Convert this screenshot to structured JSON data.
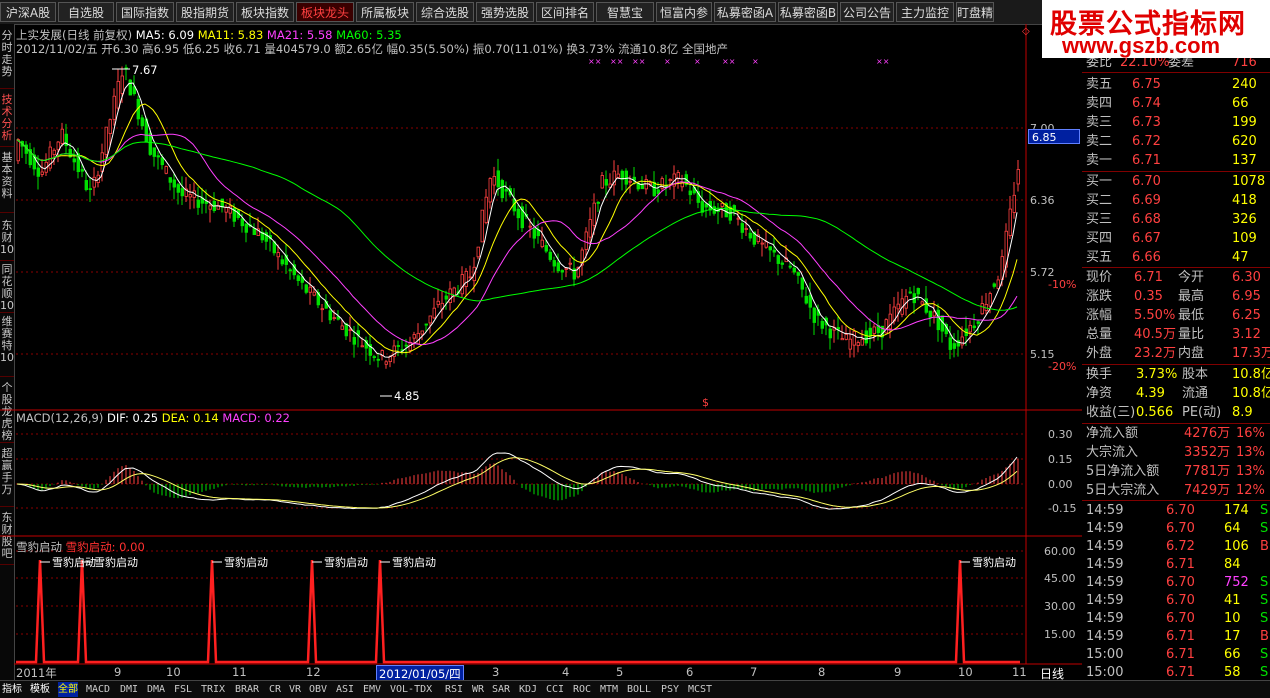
{
  "top_tabs": [
    {
      "label": "沪深A股",
      "active": false
    },
    {
      "label": "自选股",
      "active": false
    },
    {
      "label": "国际指数",
      "active": false
    },
    {
      "label": "股指期货",
      "active": false
    },
    {
      "label": "板块指数",
      "active": false
    },
    {
      "label": "板块龙头",
      "active": true
    },
    {
      "label": "所属板块",
      "active": false
    },
    {
      "label": "综合选股",
      "active": false
    },
    {
      "label": "强势选股",
      "active": false
    },
    {
      "label": "区间排名",
      "active": false
    },
    {
      "label": "智慧宝",
      "active": false
    },
    {
      "label": "恒富内参",
      "active": false
    },
    {
      "label": "私募密函A",
      "active": false
    },
    {
      "label": "私募密函B",
      "active": false
    },
    {
      "label": "公司公告",
      "active": false
    },
    {
      "label": "主力监控",
      "active": false
    },
    {
      "label": "盯盘精",
      "active": false
    }
  ],
  "brand": {
    "line1": "股票公式指标网",
    "line2": "www.gszb.com"
  },
  "side_tabs": [
    "分时走势",
    "技术分析",
    "基本资料",
    "东财10",
    "同花顺10",
    "维赛特10",
    "个股龙虎榜",
    "超赢手万",
    "东财股吧"
  ],
  "side_active": 1,
  "main_header": {
    "line1_prefix": "上实发展(日线 前复权)",
    "ma5": "MA5: 6.09",
    "ma11": "MA11: 5.83",
    "ma21": "MA21: 5.58",
    "ma60": "MA60: 5.35",
    "line2": "2012/11/02/五 开6.30 高6.95 低6.25 收6.71 量404579.0 额2.65亿 幅0.35(5.50%) 振0.70(11.01%) 换3.73% 流通10.8亿 全国地产",
    "high_label": "7.67",
    "low_label": "4.85",
    "xx_marks": [
      "××",
      "××",
      "××",
      "×",
      "×",
      "××",
      "×",
      "××"
    ]
  },
  "price_axis": [
    {
      "value": "7.00",
      "pct": ""
    },
    {
      "value": "6.36",
      "pct": ""
    },
    {
      "value": "5.72",
      "pct": "-10%"
    },
    {
      "value": "5.15",
      "pct": "-20%"
    }
  ],
  "last_price_tag": "6.85",
  "macd_header": {
    "label": "MACD(12,26,9)",
    "dif": "DIF: 0.25",
    "dea": "DEA: 0.14",
    "macd": "MACD: 0.22"
  },
  "macd_axis": [
    "0.30",
    "0.15",
    "0.00",
    "-0.15"
  ],
  "sig_header": {
    "name": "雪豹启动",
    "value_label": "雪豹启动: 0.00"
  },
  "sig_axis": [
    "60.00",
    "45.00",
    "30.00",
    "15.00"
  ],
  "sig_label": "雪豹启动",
  "date_ticks": [
    "2011年",
    "9",
    "10",
    "11",
    "12",
    "2012/01/05/四",
    "3",
    "4",
    "5",
    "6",
    "7",
    "8",
    "9",
    "10",
    "11"
  ],
  "period_label": "日线",
  "bottom_tabs": [
    "指标",
    "模板",
    "全部",
    "MACD",
    "DMI",
    "DMA",
    "FSL",
    "TRIX",
    "BRAR",
    "CR",
    "VR",
    "OBV",
    "ASI",
    "EMV",
    "VOL-TDX",
    "RSI",
    "WR",
    "SAR",
    "KDJ",
    "CCI",
    "ROC",
    "MTM",
    "BOLL",
    "PSY",
    "MCST"
  ],
  "quote": {
    "ratio": {
      "label": "委比",
      "value": "22.10%",
      "label2": "委差",
      "value2": "716"
    },
    "sells": [
      {
        "label": "卖五",
        "price": "6.75",
        "vol": "240"
      },
      {
        "label": "卖四",
        "price": "6.74",
        "vol": "66"
      },
      {
        "label": "卖三",
        "price": "6.73",
        "vol": "199"
      },
      {
        "label": "卖二",
        "price": "6.72",
        "vol": "620"
      },
      {
        "label": "卖一",
        "price": "6.71",
        "vol": "137"
      }
    ],
    "buys": [
      {
        "label": "买一",
        "price": "6.70",
        "vol": "1078"
      },
      {
        "label": "买二",
        "price": "6.69",
        "vol": "418"
      },
      {
        "label": "买三",
        "price": "6.68",
        "vol": "326"
      },
      {
        "label": "买四",
        "price": "6.67",
        "vol": "109"
      },
      {
        "label": "买五",
        "price": "6.66",
        "vol": "47"
      }
    ],
    "stats": [
      {
        "l1": "现价",
        "v1": "6.71",
        "l2": "今开",
        "v2": "6.30"
      },
      {
        "l1": "涨跌",
        "v1": "0.35",
        "l2": "最高",
        "v2": "6.95"
      },
      {
        "l1": "涨幅",
        "v1": "5.50%",
        "l2": "最低",
        "v2": "6.25"
      },
      {
        "l1": "总量",
        "v1": "40.5万",
        "l2": "量比",
        "v2": "3.12"
      },
      {
        "l1": "外盘",
        "v1": "23.2万",
        "l2": "内盘",
        "v2": "17.3万"
      }
    ],
    "stats2": [
      {
        "l1": "换手",
        "v1": "3.73%",
        "l2": "股本",
        "v2": "10.8亿"
      },
      {
        "l1": "净资",
        "v1": "4.39",
        "l2": "流通",
        "v2": "10.8亿"
      },
      {
        "l1": "收益(三)",
        "v1": "0.566",
        "l2": "PE(动)",
        "v2": "8.9"
      }
    ],
    "flows": [
      {
        "label": "净流入额",
        "value": "4276万",
        "pct": "16%"
      },
      {
        "label": "大宗流入",
        "value": "3352万",
        "pct": "13%"
      },
      {
        "label": "5日净流入额",
        "value": "7781万",
        "pct": "13%"
      },
      {
        "label": "5日大宗流入",
        "value": "7429万",
        "pct": "12%"
      }
    ],
    "ticks": [
      {
        "time": "14:59",
        "price": "6.70",
        "vol": "174",
        "side": "S"
      },
      {
        "time": "14:59",
        "price": "6.70",
        "vol": "64",
        "side": "S"
      },
      {
        "time": "14:59",
        "price": "6.72",
        "vol": "106",
        "side": "B"
      },
      {
        "time": "14:59",
        "price": "6.71",
        "vol": "84",
        "side": ""
      },
      {
        "time": "14:59",
        "price": "6.70",
        "vol": "752",
        "side": "S"
      },
      {
        "time": "14:59",
        "price": "6.70",
        "vol": "41",
        "side": "S"
      },
      {
        "time": "14:59",
        "price": "6.70",
        "vol": "10",
        "side": "S"
      },
      {
        "time": "14:59",
        "price": "6.71",
        "vol": "17",
        "side": "B"
      },
      {
        "time": "15:00",
        "price": "6.71",
        "vol": "66",
        "side": "S"
      },
      {
        "time": "15:00",
        "price": "6.71",
        "vol": "58",
        "side": "S"
      }
    ]
  },
  "colors": {
    "up": "#ff4040",
    "down": "#00e000",
    "ma5": "#ffffff",
    "ma11": "#ffff00",
    "ma21": "#ff40ff",
    "ma60": "#00ff00",
    "grid": "#8a0000",
    "axis": "#c00000",
    "signal": "#ff2020"
  }
}
